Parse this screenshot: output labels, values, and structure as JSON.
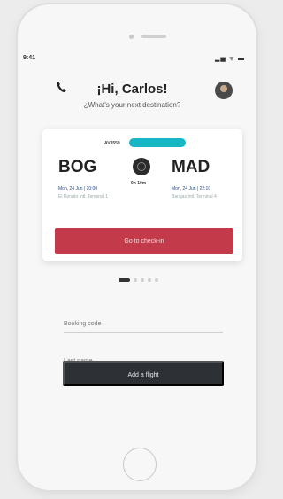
{
  "status_bar": {
    "time": "9:41",
    "icons": "▂▅ ᯤ ▬"
  },
  "header": {
    "greeting": "¡Hi, Carlos!",
    "subtitle": "¿What's your next destination?",
    "back_icon": "phone-back-icon",
    "avatar_icon": "user-avatar"
  },
  "flight_card": {
    "flight_number": "AV8559",
    "status_badge": "",
    "origin": {
      "code": "BOG",
      "date": "Mon, 24 Jun | 20:00",
      "airport": "El Dorado Intl.\nTerminal 1"
    },
    "destination": {
      "code": "MAD",
      "date": "Mon, 24 Jun | 22:10",
      "airport": "Barajas Intl.\nTerminal 4"
    },
    "duration": "9h 10m",
    "checkin_label": "Go to check-in"
  },
  "pagination": {
    "active": 0,
    "count": 5
  },
  "form": {
    "booking_code_placeholder": "Booking code",
    "last_name_placeholder": "Last name",
    "add_flight_label": "Add a flight"
  },
  "colors": {
    "accent": "#c33a4a",
    "badge": "#16b6c6",
    "dark_button": "#2d3035"
  }
}
